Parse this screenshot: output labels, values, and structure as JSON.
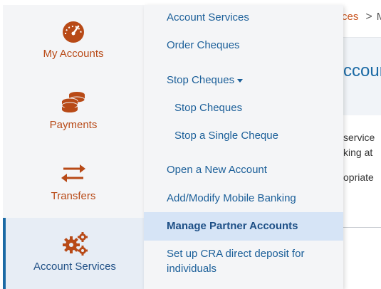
{
  "background": {
    "breadcrumb_current": "ces",
    "breadcrumb_next": "M",
    "heading": "ccoun",
    "text_lines": [
      "service",
      "king at",
      "opriate"
    ]
  },
  "sidebar": {
    "items": [
      {
        "label": "My Accounts",
        "icon": "speedometer-icon"
      },
      {
        "label": "Payments",
        "icon": "coins-icon"
      },
      {
        "label": "Transfers",
        "icon": "transfer-arrows-icon"
      },
      {
        "label": "Account Services",
        "icon": "gears-icon"
      }
    ],
    "active_index": 3
  },
  "submenu": {
    "items": [
      {
        "label": "Account Services"
      },
      {
        "label": "Order Cheques"
      },
      {
        "label": "Stop Cheques"
      },
      {
        "label": "Stop Cheques"
      },
      {
        "label": "Stop a Single Cheque"
      },
      {
        "label": "Open a New Account"
      },
      {
        "label": "Add/Modify Mobile Banking"
      },
      {
        "label": "Manage Partner Accounts"
      },
      {
        "label": "Set up CRA direct deposit for individuals"
      }
    ],
    "active_index": 7
  },
  "colors": {
    "accent_orange": "#b84a17",
    "link_blue": "#1b5f99",
    "active_bg": "#d6e4f6"
  }
}
